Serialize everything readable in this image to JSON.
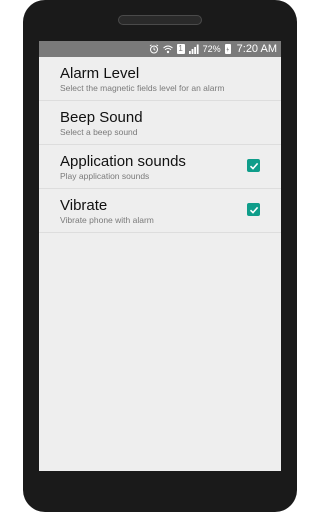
{
  "status_bar": {
    "battery_percent": "72%",
    "time": "7:20 AM"
  },
  "settings": {
    "items": [
      {
        "title": "Alarm Level",
        "summary": "Select the magnetic fields level for an alarm"
      },
      {
        "title": "Beep Sound",
        "summary": "Select a beep sound"
      },
      {
        "title": "Application sounds",
        "summary": "Play application sounds",
        "checked": true
      },
      {
        "title": "Vibrate",
        "summary": "Vibrate phone with alarm",
        "checked": true
      }
    ]
  },
  "colors": {
    "accent": "#0f9d8a",
    "status_bar": "#7a7a7a",
    "screen_bg": "#eeeeee"
  }
}
